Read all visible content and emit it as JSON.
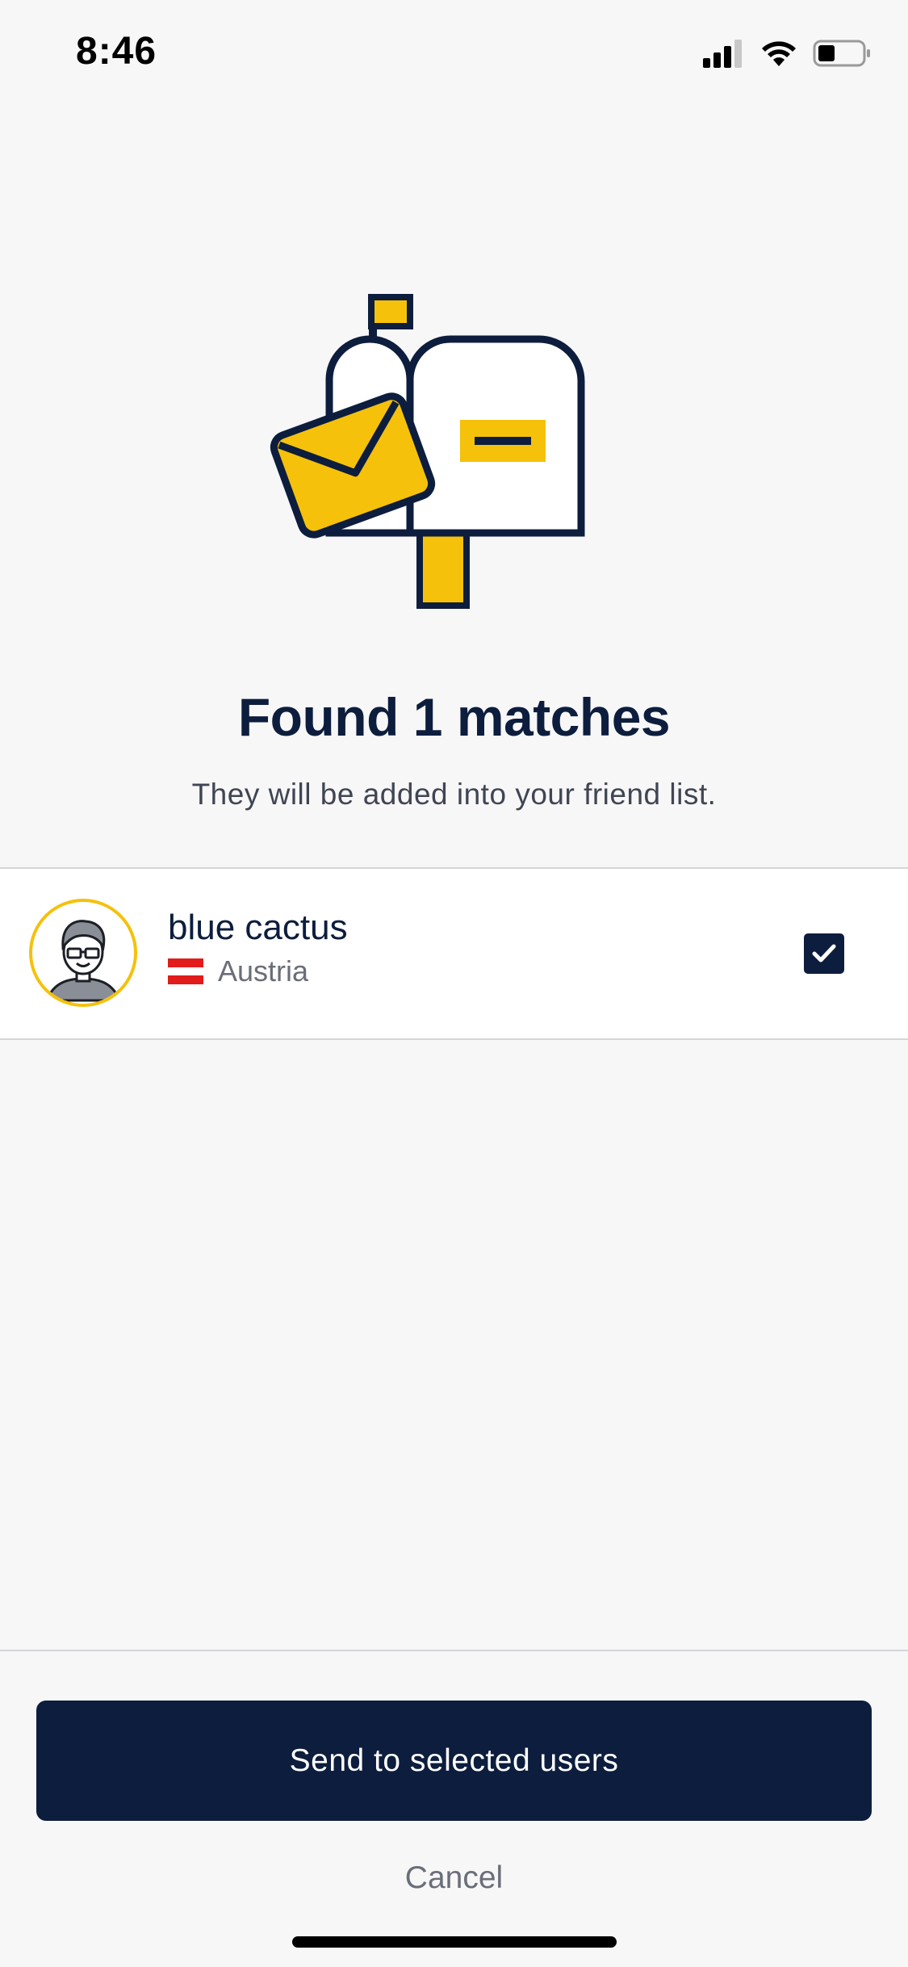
{
  "status_bar": {
    "time": "8:46"
  },
  "header": {
    "title": "Found 1 matches",
    "subtitle": "They will be added into your friend list."
  },
  "matches": [
    {
      "name": "blue cactus",
      "country": "Austria",
      "selected": true
    }
  ],
  "actions": {
    "send_label": "Send to selected users",
    "cancel_label": "Cancel"
  },
  "colors": {
    "navy": "#0d1d3d",
    "accent_yellow": "#f5c10a",
    "background": "#f7f7f8"
  },
  "icons": {
    "illustration": "mailbox-icon",
    "checkbox": "check-icon"
  }
}
